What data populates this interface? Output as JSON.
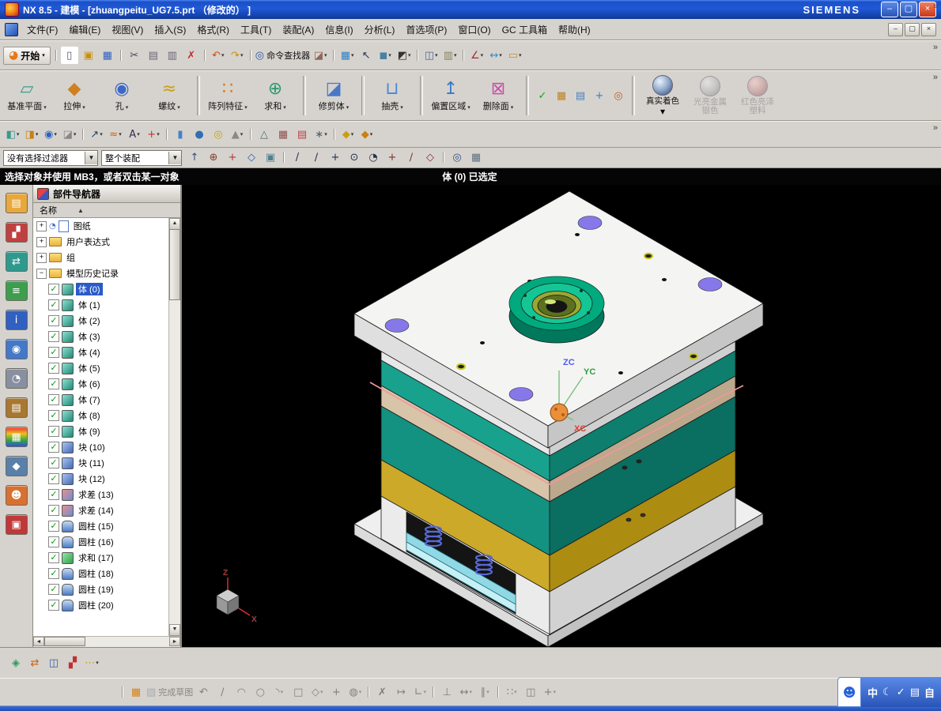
{
  "window": {
    "title": "NX 8.5 - 建模 - [zhuangpeitu_UG7.5.prt （修改的） ]",
    "brand": "SIEMENS",
    "controls": {
      "minimize": "–",
      "maximize": "▢",
      "close": "×"
    }
  },
  "glyphs": {
    "overflow": "»",
    "sort": "▲",
    "expand": "+",
    "collapse": "−",
    "check": "✓",
    "dropdown": "▾"
  },
  "menubar": {
    "items": [
      "文件(F)",
      "编辑(E)",
      "视图(V)",
      "插入(S)",
      "格式(R)",
      "工具(T)",
      "装配(A)",
      "信息(I)",
      "分析(L)",
      "首选项(P)",
      "窗口(O)",
      "GC 工具箱",
      "帮助(H)"
    ]
  },
  "toolbar_standard": {
    "start": "开始"
  },
  "toolbars": {
    "standard": [
      {
        "sep": true
      },
      {
        "name": "new-file",
        "glyph": "▯",
        "color": "#556",
        "bg": "#FFFFFF"
      },
      {
        "name": "open",
        "glyph": "▣",
        "color": "#C89010"
      },
      {
        "name": "save",
        "glyph": "▦",
        "color": "#3060C0"
      },
      {
        "sep": true
      },
      {
        "name": "cut",
        "glyph": "✂",
        "color": "#445"
      },
      {
        "name": "copy",
        "glyph": "▤",
        "color": "#667"
      },
      {
        "name": "paste",
        "glyph": "▥",
        "color": "#667"
      },
      {
        "name": "delete",
        "glyph": "✗",
        "color": "#C03030"
      },
      {
        "sep": true
      },
      {
        "name": "undo",
        "glyph": "↶",
        "color": "#C85010",
        "arrow": true
      },
      {
        "name": "redo",
        "glyph": "↷",
        "color": "#C89010",
        "arrow": true
      },
      {
        "sep": true
      },
      {
        "name": "command-finder",
        "glyph": "◎",
        "color": "#3058A0",
        "label": "命令查找器"
      },
      {
        "name": "erase-display",
        "glyph": "◪",
        "color": "#906858",
        "arrow": true
      },
      {
        "sep": true
      },
      {
        "name": "fit-view",
        "glyph": "▦",
        "color": "#3080C8",
        "arrow": true
      },
      {
        "name": "select-cursor",
        "glyph": "↖",
        "color": "#223355"
      },
      {
        "name": "shaded-display",
        "glyph": "◼",
        "color": "#4880A8",
        "arrow": true
      },
      {
        "name": "display-mode",
        "glyph": "◩",
        "color": "#333333",
        "arrow": true
      },
      {
        "sep": true
      },
      {
        "name": "window-layout",
        "glyph": "◫",
        "color": "#506890",
        "arrow": true
      },
      {
        "name": "snapshot",
        "glyph": "▥",
        "color": "#888060",
        "arrow": true
      },
      {
        "sep": true
      },
      {
        "name": "measure-angle",
        "glyph": "∠",
        "color": "#A03030",
        "arrow": true
      },
      {
        "name": "measure-distance",
        "glyph": "↔",
        "color": "#3090C0",
        "arrow": true
      },
      {
        "name": "ruler",
        "glyph": "▭",
        "color": "#C09030",
        "arrow": true
      }
    ],
    "row3": [
      {
        "name": "datum-plane-small",
        "glyph": "◧",
        "color": "#3A9A8A",
        "arrow": true
      },
      {
        "name": "extrude-small",
        "glyph": "◨",
        "color": "#C88010",
        "arrow": true
      },
      {
        "name": "hole-small",
        "glyph": "◉",
        "color": "#3060C0",
        "arrow": true
      },
      {
        "name": "boss-small",
        "glyph": "◪",
        "color": "#888888",
        "arrow": true
      },
      {
        "sep": true
      },
      {
        "name": "sketch",
        "glyph": "↗",
        "color": "#204060",
        "arrow": true
      },
      {
        "name": "curve",
        "glyph": "≈",
        "color": "#C86010",
        "arrow": true
      },
      {
        "name": "text-tool",
        "glyph": "A",
        "color": "#303050",
        "arrow": true
      },
      {
        "name": "point-tool",
        "glyph": "+",
        "color": "#C03030",
        "arrow": true
      },
      {
        "sep": true
      },
      {
        "name": "cylinder-tool",
        "glyph": "▮",
        "color": "#4880C8"
      },
      {
        "name": "sphere-tool",
        "glyph": "●",
        "color": "#3070B0"
      },
      {
        "name": "torus-tool",
        "glyph": "◎",
        "color": "#C8A010"
      },
      {
        "name": "cone-tool",
        "glyph": "▲",
        "color": "#888888",
        "arrow": true
      },
      {
        "sep": true
      },
      {
        "name": "facet-body",
        "glyph": "△",
        "color": "#507070"
      },
      {
        "name": "expressions-table",
        "glyph": "▦",
        "color": "#905050"
      },
      {
        "name": "spreadsheet",
        "glyph": "▤",
        "color": "#C04040"
      },
      {
        "name": "utility-tools",
        "glyph": "∗",
        "color": "#506070",
        "arrow": true
      },
      {
        "sep": true
      },
      {
        "name": "assembly-constraint",
        "glyph": "◆",
        "color": "#C8A010",
        "arrow": true
      },
      {
        "name": "assembly-move",
        "glyph": "◆",
        "color": "#C88010",
        "arrow": true
      }
    ],
    "selection": [
      {
        "name": "type-filter-up",
        "glyph": "↑",
        "color": "#305080"
      },
      {
        "name": "general-selection",
        "glyph": "⊕",
        "color": "#804030"
      },
      {
        "name": "snap-plus",
        "glyph": "+",
        "color": "#C03030"
      },
      {
        "name": "solid-face-filter",
        "glyph": "◇",
        "color": "#3060A0"
      },
      {
        "name": "plane-filter",
        "glyph": "▣",
        "color": "#508090"
      },
      {
        "sep": true
      },
      {
        "name": "snap-endpoint",
        "glyph": "/",
        "color": "#203050"
      },
      {
        "name": "snap-midpoint",
        "glyph": "∕",
        "color": "#203050"
      },
      {
        "name": "snap-intersection",
        "glyph": "+",
        "color": "#203050"
      },
      {
        "name": "snap-arc-center",
        "glyph": "⊙",
        "color": "#203050"
      },
      {
        "name": "snap-quadrant",
        "glyph": "◔",
        "color": "#203050"
      },
      {
        "name": "snap-existing-point",
        "glyph": "+",
        "color": "#803030"
      },
      {
        "name": "snap-point-on-curve",
        "glyph": "∕",
        "color": "#803030"
      },
      {
        "name": "snap-point-on-face",
        "glyph": "◇",
        "color": "#803030"
      },
      {
        "sep": true
      },
      {
        "name": "magnify-region",
        "glyph": "◎",
        "color": "#305080"
      },
      {
        "name": "grid-snap",
        "glyph": "▦",
        "color": "#607080"
      }
    ],
    "nav_bottom": [
      {
        "name": "create-in-window",
        "glyph": "◈",
        "color": "#2A9A5A"
      },
      {
        "name": "swap-views",
        "glyph": "⇄",
        "color": "#C86010"
      },
      {
        "name": "window-view",
        "glyph": "◫",
        "color": "#3060A0"
      },
      {
        "name": "close-inspector",
        "glyph": "▞",
        "color": "#C03030"
      },
      {
        "name": "more-options",
        "glyph": "⋯",
        "color": "#C8A010",
        "arrow": true
      }
    ],
    "sketch": [
      {
        "sep": true
      },
      {
        "name": "sketch-grid",
        "glyph": "▦",
        "color": "#D88010"
      },
      {
        "name": "finish-sketch",
        "glyph": "▨",
        "color": "#607080",
        "label": "完成草图",
        "disabled": true
      },
      {
        "name": "profile",
        "glyph": "↶",
        "disabled": true
      },
      {
        "name": "line",
        "glyph": "∕",
        "disabled": true
      },
      {
        "name": "arc",
        "glyph": "◠",
        "disabled": true
      },
      {
        "name": "circle",
        "glyph": "○",
        "disabled": true
      },
      {
        "name": "fillet",
        "glyph": "◝",
        "disabled": true,
        "arrow": true
      },
      {
        "name": "rectangle",
        "glyph": "□",
        "disabled": true
      },
      {
        "name": "polygon",
        "glyph": "◇",
        "disabled": true,
        "arrow": true
      },
      {
        "name": "sketch-point",
        "glyph": "+",
        "disabled": true
      },
      {
        "name": "ellipse",
        "glyph": "◍",
        "disabled": true,
        "arrow": true
      },
      {
        "sep": true
      },
      {
        "name": "quick-trim",
        "glyph": "✗",
        "disabled": true
      },
      {
        "name": "quick-extend",
        "glyph": "↦",
        "disabled": true
      },
      {
        "name": "make-corner",
        "glyph": "∟",
        "disabled": true,
        "arrow": true
      },
      {
        "sep": true
      },
      {
        "name": "geometric-constraints",
        "glyph": "⊥",
        "disabled": true
      },
      {
        "name": "dimensions",
        "glyph": "↔",
        "disabled": true,
        "arrow": true
      },
      {
        "name": "show-constraints",
        "glyph": "∥",
        "disabled": true,
        "arrow": true
      },
      {
        "sep": true
      },
      {
        "name": "pattern-curve",
        "glyph": "∷",
        "disabled": true,
        "arrow": true
      },
      {
        "name": "mirror-curve",
        "glyph": "◫",
        "disabled": true
      },
      {
        "name": "intersection-point",
        "glyph": "+",
        "disabled": true,
        "arrow": true
      }
    ]
  },
  "toolbar_feature": {
    "buttons": [
      {
        "label": "基准平面",
        "name": "datum-plane",
        "glyph": "▱",
        "color": "#3E9E8E"
      },
      {
        "label": "拉伸",
        "name": "extrude",
        "glyph": "◆",
        "color": "#D08020"
      },
      {
        "label": "孔",
        "name": "hole",
        "glyph": "◉",
        "color": "#3A68C8"
      },
      {
        "label": "螺纹",
        "name": "thread",
        "glyph": "≈",
        "color": "#C8A018"
      },
      {
        "sep": true
      },
      {
        "label": "阵列特征",
        "name": "pattern-feature",
        "glyph": "∷",
        "color": "#D87818"
      },
      {
        "label": "求和",
        "name": "unite",
        "glyph": "⊕",
        "color": "#2A9A70"
      },
      {
        "sep": true
      },
      {
        "label": "修剪体",
        "name": "trim-body",
        "glyph": "◪",
        "color": "#4878C8"
      },
      {
        "sep": true
      },
      {
        "label": "抽壳",
        "name": "shell",
        "glyph": "⊔",
        "color": "#4888D8"
      },
      {
        "sep": true
      },
      {
        "label": "偏置区域",
        "name": "offset-region",
        "glyph": "↥",
        "color": "#3878C8"
      },
      {
        "label": "删除面",
        "name": "delete-face",
        "glyph": "⊠",
        "color": "#C850A8"
      }
    ],
    "extras": [
      {
        "name": "kf-check",
        "glyph": "✓",
        "color": "#18A018"
      },
      {
        "name": "expressions",
        "glyph": "▦",
        "color": "#C08020"
      },
      {
        "name": "part-families",
        "glyph": "▤",
        "color": "#4880C0"
      },
      {
        "name": "wcs-orient",
        "glyph": "+",
        "color": "#3080C8"
      },
      {
        "name": "datum-csys",
        "glyph": "◎",
        "color": "#C06020"
      }
    ],
    "shading": [
      {
        "label": "真实着色",
        "name": "true-shading",
        "enabled": true,
        "arrow": true,
        "sphere": "radial-gradient(circle at 35% 30%,#EAF2FF,#8FA8C8 50%,#46608C 85%)"
      },
      {
        "label": "光亮金属银色",
        "name": "shiny-metal-silver",
        "enabled": false,
        "sphere": "radial-gradient(circle at 35% 30%,#EEEEEE,#BBBBBB 50%,#888888 85%)"
      },
      {
        "label": "红色亮泽塑料",
        "name": "red-glossy-plastic",
        "enabled": false,
        "sphere": "radial-gradient(circle at 35% 30%,#F8CCCC,#C89090 50%,#906060 85%)"
      }
    ]
  },
  "selection_bar": {
    "filter_value": "没有选择过滤器",
    "scope_value": "整个装配"
  },
  "prompt_bar": {
    "message": "选择对象并使用 MB3，或者双击某一对象",
    "status": "体 (0) 已选定"
  },
  "resource_bar": {
    "icons": [
      {
        "name": "assembly-navigator",
        "glyph": "▤",
        "bg": "#E8A83B"
      },
      {
        "name": "constraint-navigator",
        "glyph": "▞",
        "bg": "#C04040"
      },
      {
        "name": "part-navigator",
        "glyph": "⇄",
        "bg": "#2E9A8E"
      },
      {
        "name": "reuse-library",
        "glyph": "≡",
        "bg": "#3E9E4E"
      },
      {
        "name": "hd3d-tools",
        "glyph": "i",
        "bg": "#3060C0"
      },
      {
        "name": "web-browser",
        "glyph": "◉",
        "bg": "#4478C8"
      },
      {
        "name": "history-palette",
        "glyph": "◔",
        "bg": "#8890A0"
      },
      {
        "name": "system-materials",
        "glyph": "▤",
        "bg": "#A87830"
      },
      {
        "name": "color-palette",
        "glyph": "▦",
        "bg": "linear-gradient(180deg,#E83030,#F0C020,#38A838,#3050E0)"
      },
      {
        "name": "process-studio",
        "glyph": "◆",
        "bg": "#5880A8"
      },
      {
        "name": "roles",
        "glyph": "☻",
        "bg": "#D87030"
      },
      {
        "name": "system-scenes",
        "glyph": "▣",
        "bg": "#C03838"
      }
    ]
  },
  "navigator": {
    "title": "部件导航器",
    "name_column": "名称",
    "groups": [
      {
        "label": "图纸",
        "expanded": false,
        "icon": "sheet"
      },
      {
        "label": "用户表达式",
        "expanded": false,
        "icon": "folder"
      },
      {
        "label": "组",
        "expanded": false,
        "icon": "folder"
      },
      {
        "label": "模型历史记录",
        "expanded": true,
        "icon": "folder"
      }
    ],
    "history": [
      {
        "label": "体 (0)",
        "icon": "body",
        "selected": true
      },
      {
        "label": "体 (1)",
        "icon": "body"
      },
      {
        "label": "体 (2)",
        "icon": "body"
      },
      {
        "label": "体 (3)",
        "icon": "body"
      },
      {
        "label": "体 (4)",
        "icon": "body"
      },
      {
        "label": "体 (5)",
        "icon": "body"
      },
      {
        "label": "体 (6)",
        "icon": "body"
      },
      {
        "label": "体 (7)",
        "icon": "body"
      },
      {
        "label": "体 (8)",
        "icon": "body"
      },
      {
        "label": "体 (9)",
        "icon": "body"
      },
      {
        "label": "块 (10)",
        "icon": "block"
      },
      {
        "label": "块 (11)",
        "icon": "block"
      },
      {
        "label": "块 (12)",
        "icon": "block"
      },
      {
        "label": "求差 (13)",
        "icon": "subtract"
      },
      {
        "label": "求差 (14)",
        "icon": "subtract"
      },
      {
        "label": "圆柱 (15)",
        "icon": "cylinder"
      },
      {
        "label": "圆柱 (16)",
        "icon": "cylinder"
      },
      {
        "label": "求和 (17)",
        "icon": "unite"
      },
      {
        "label": "圆柱 (18)",
        "icon": "cylinder"
      },
      {
        "label": "圆柱 (19)",
        "icon": "cylinder"
      },
      {
        "label": "圆柱 (20)",
        "icon": "cylinder"
      }
    ]
  },
  "viewport": {
    "triad": {
      "z": "ZC",
      "y": "YC",
      "x": "XC"
    },
    "orient_cube": {
      "z": "Z",
      "x": "X"
    }
  },
  "ime": {
    "items": [
      "中",
      "☾",
      "✓",
      "▤",
      "自"
    ]
  },
  "colors": {
    "titlebar_blue": "#1C50C8",
    "selection_blue": "#2A5AC8",
    "toolbar_gray": "#D6D3CE",
    "viewport_bg": "#000000",
    "prompt_bg": "#050505",
    "model_teal_plate": "#18A28E",
    "model_yellow_plate": "#CDA92A",
    "model_tan_plate": "#D8C4A8",
    "model_green_boss": "#00AA7E",
    "model_purple_hole": "#8678E8",
    "spring_blue": "#5868D8",
    "ejector_cyan": "#8FD8E4"
  }
}
